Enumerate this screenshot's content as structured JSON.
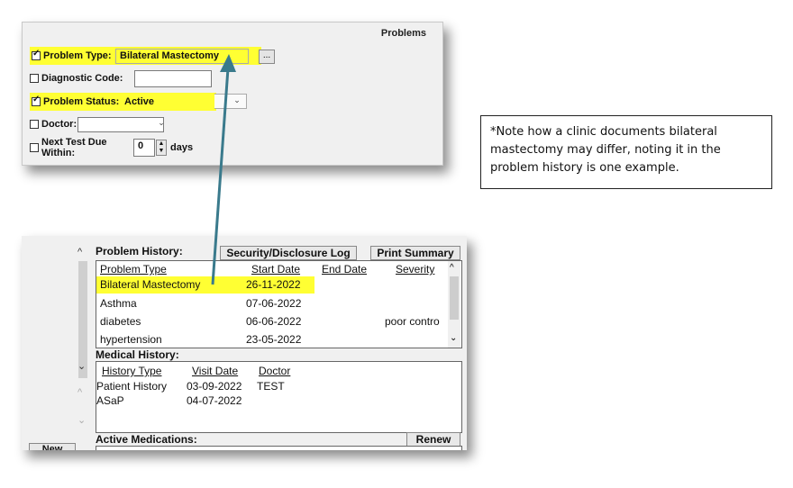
{
  "problem_form": {
    "header": "Problems",
    "problem_type": {
      "label": "Problem Type:",
      "value": "Bilateral Mastectomy",
      "checked": true,
      "browse_label": "..."
    },
    "diagnostic_code": {
      "label": "Diagnostic Code:",
      "value": "",
      "checked": false
    },
    "problem_status": {
      "label": "Problem Status:",
      "value": "Active",
      "checked": true
    },
    "doctor": {
      "label": "Doctor:",
      "value": "",
      "checked": false
    },
    "next_test": {
      "label": "Next Test Due Within:",
      "value": "0",
      "unit": "days",
      "checked": false
    }
  },
  "note": {
    "text": "*Note how a clinic documents bilateral mastectomy may differ, noting it in the problem history is one example."
  },
  "problem_history": {
    "label": "Problem History:",
    "security_button": "Security/Disclosure Log",
    "print_button": "Print Summary",
    "columns": [
      "Problem Type",
      "Start Date",
      "End Date",
      "Severity"
    ],
    "rows": [
      {
        "type": "Bilateral Mastectomy",
        "start": "26-11-2022",
        "end": "",
        "severity": ""
      },
      {
        "type": "Asthma",
        "start": "07-06-2022",
        "end": "",
        "severity": ""
      },
      {
        "type": "diabetes",
        "start": "06-06-2022",
        "end": "",
        "severity": "poor contro"
      },
      {
        "type": "hypertension",
        "start": "23-05-2022",
        "end": "",
        "severity": ""
      }
    ]
  },
  "medical_history": {
    "label": "Medical History:",
    "columns": [
      "History Type",
      "Visit Date",
      "Doctor"
    ],
    "rows": [
      {
        "type": "Patient History",
        "date": "03-09-2022",
        "doctor": "TEST"
      },
      {
        "type": "ASaP",
        "date": "04-07-2022",
        "doctor": ""
      }
    ]
  },
  "active_medications": {
    "label": "Active Medications:",
    "renew_button": "Renew"
  },
  "left_nav": {
    "new_button": "New"
  },
  "colors": {
    "highlight": "#ffff33",
    "arrow": "#3a7a8c"
  }
}
